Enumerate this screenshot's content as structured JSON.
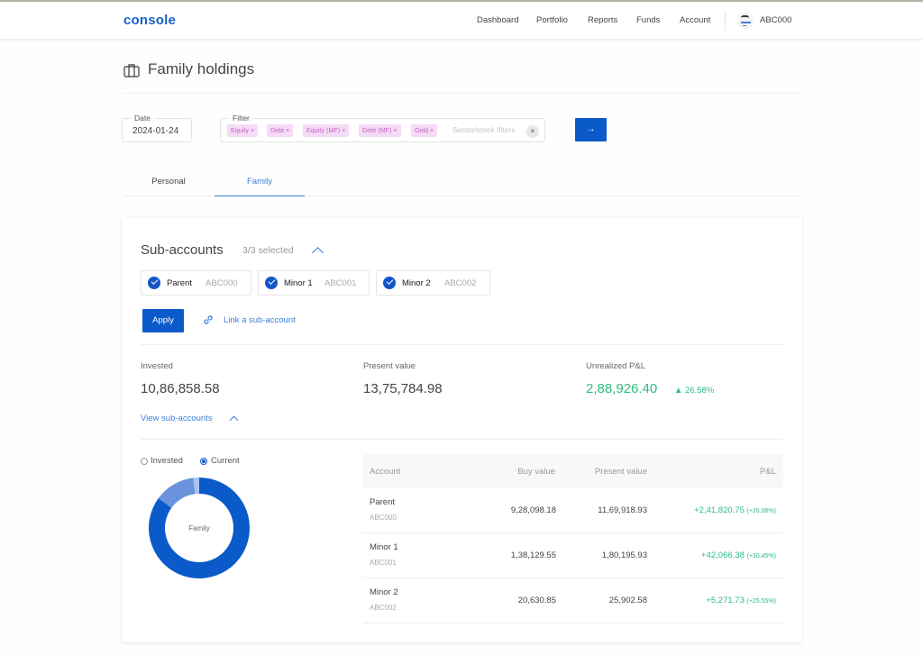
{
  "app": {
    "logo": "console",
    "nav": [
      "Dashboard",
      "Portfolio",
      "Reports",
      "Funds",
      "Account"
    ],
    "user_id": "ABC000"
  },
  "page": {
    "title": "Family holdings",
    "title_icon": "briefcase-icon"
  },
  "filters": {
    "date_label": "Date",
    "date_value": "2024-01-24",
    "filter_label": "Filter",
    "chips": [
      "Equity ×",
      "Debt ×",
      "Equity (MF) ×",
      "Debt (MF) ×",
      "Gold ×"
    ],
    "placeholder": "Sector/stock filters",
    "clear_glyph": "×",
    "go_glyph": "→"
  },
  "tabs": [
    {
      "label": "Personal",
      "active": false
    },
    {
      "label": "Family",
      "active": true
    }
  ],
  "sub_accounts": {
    "title": "Sub-accounts",
    "selected_count": "3/3 selected",
    "accounts": [
      {
        "name": "Parent",
        "id": "ABC000",
        "checked": true
      },
      {
        "name": "Minor 1",
        "id": "ABC001",
        "checked": true
      },
      {
        "name": "Minor 2",
        "id": "ABC002",
        "checked": true
      }
    ],
    "apply_label": "Apply",
    "link_label": "Link a sub-account"
  },
  "summary": {
    "invested_label": "Invested",
    "invested_value": "10,86,858.58",
    "present_label": "Present value",
    "present_value": "13,75,784.98",
    "pnl_label": "Unrealized P&L",
    "pnl_value": "2,88,926.40",
    "pnl_pct": "▲ 26.58%",
    "view_sub_label": "View sub-accounts"
  },
  "chart_toggle": {
    "options": [
      "Invested",
      "Current"
    ],
    "selected": "Current"
  },
  "chart_data": {
    "type": "pie",
    "title": "Family",
    "mode": "Current",
    "labels": [
      "Parent",
      "Minor 1",
      "Minor 2"
    ],
    "values": [
      1169918.93,
      180195.93,
      25902.58
    ],
    "colors": [
      "#0b5ac9",
      "#6a93dd",
      "#a9c2ef"
    ]
  },
  "table": {
    "headers": [
      "Account",
      "Buy value",
      "Present value",
      "P&L"
    ],
    "rows": [
      {
        "name": "Parent",
        "id": "ABC000",
        "buy": "9,28,098.18",
        "present": "11,69,918.93",
        "pnl": "+2,41,820.75",
        "pnl_pct": "(+26.06%)"
      },
      {
        "name": "Minor 1",
        "id": "ABC001",
        "buy": "1,38,129.55",
        "present": "1,80,195.93",
        "pnl": "+42,066.38",
        "pnl_pct": "(+30.45%)"
      },
      {
        "name": "Minor 2",
        "id": "ABC002",
        "buy": "20,630.85",
        "present": "25,902.58",
        "pnl": "+5,271.73",
        "pnl_pct": "(+25.55%)"
      }
    ]
  },
  "colors": {
    "brand": "#1461c8",
    "primary_button": "#0b5ac9",
    "link": "#3b7fd9",
    "positive": "#2cbd82",
    "chip_bg": "#f5dcf6",
    "chip_text": "#c860c8"
  }
}
